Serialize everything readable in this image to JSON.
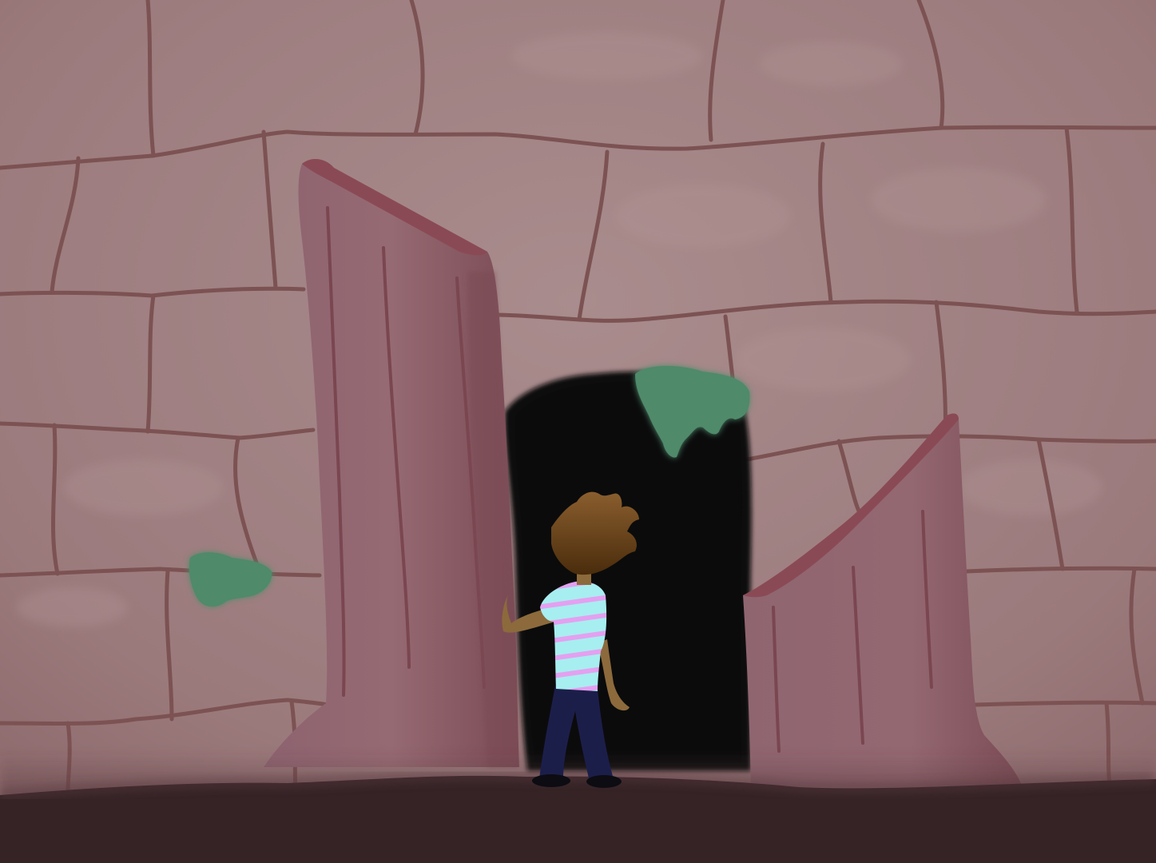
{
  "scene": {
    "description_tags": [
      "brick-wall",
      "ruined-pillars",
      "dark-doorway",
      "green-moss",
      "character-from-behind"
    ]
  },
  "colors": {
    "wall": "#a18384",
    "wall_highlight": "#b39596",
    "mortar": "#7c5253",
    "pillar": "#8f6169",
    "pillar_dark": "#7a4650",
    "pillar_top": "#8a4a55",
    "doorway": "#0d0d0f",
    "moss": "#4f8a6a",
    "floor": "#352326",
    "hair": "#6a4318",
    "skin": "#8c6a3c",
    "shirt": "#a7eef0",
    "shirt_stripe": "#e4a0f0",
    "pants": "#1c1e4a",
    "shoes": "#0c0c12"
  },
  "icons": {
    "character": "player-character-icon",
    "doorway": "dark-doorway-icon",
    "moss": "moss-icon"
  }
}
